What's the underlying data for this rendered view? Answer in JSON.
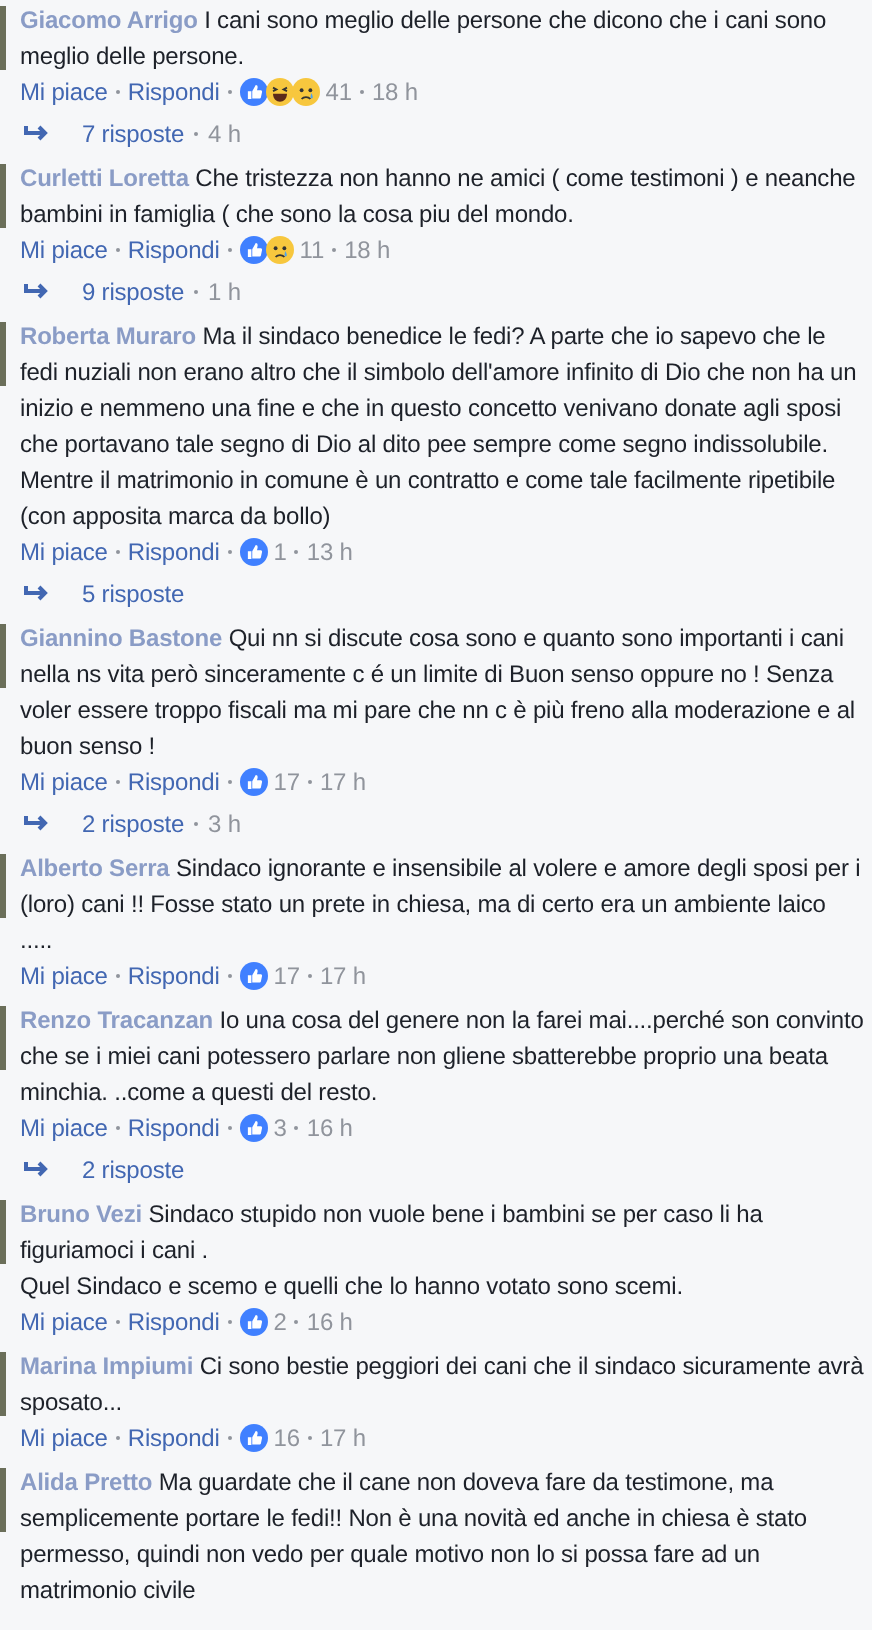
{
  "comments": [
    {
      "author": "Giacomo Arrigo",
      "text": "I cani sono meglio delle persone che dicono che i cani sono meglio delle persone.",
      "like_label": "Mi piace",
      "reply_label": "Rispondi",
      "reactions": [
        {
          "kind": "like"
        },
        {
          "kind": "haha"
        },
        {
          "kind": "sad"
        }
      ],
      "reaction_count": "41",
      "time": "18 h",
      "replies": {
        "count": "7 risposte",
        "time": "4 h"
      }
    },
    {
      "author": "Curletti Loretta",
      "text": "Che tristezza non hanno ne amici ( come testimoni ) e neanche bambini in famiglia ( che sono la cosa piu del mondo.",
      "like_label": "Mi piace",
      "reply_label": "Rispondi",
      "reactions": [
        {
          "kind": "like"
        },
        {
          "kind": "sad"
        }
      ],
      "reaction_count": "11",
      "time": "18 h",
      "replies": {
        "count": "9 risposte",
        "time": "1 h"
      }
    },
    {
      "author": "Roberta Muraro",
      "text": "Ma il sindaco benedice le fedi? A parte che io sapevo che le fedi nuziali non erano altro che il simbolo dell'amore infinito di Dio che non ha un inizio e nemmeno una fine e che in questo concetto venivano donate agli sposi che portavano tale segno di Dio al dito pee sempre come segno indissolubile. Mentre il matrimonio in comune è un contratto e come tale facilmente ripetibile (con apposita marca da bollo)",
      "like_label": "Mi piace",
      "reply_label": "Rispondi",
      "reactions": [
        {
          "kind": "like"
        }
      ],
      "reaction_count": "1",
      "time": "13 h",
      "replies": {
        "count": "5 risposte"
      }
    },
    {
      "author": "Giannino Bastone",
      "text": "Qui nn si discute cosa sono e quanto sono importanti i cani nella ns vita però sinceramente c é un limite di Buon senso oppure no ! Senza voler essere troppo fiscali ma mi pare che nn c è più freno alla moderazione e al buon senso !",
      "like_label": "Mi piace",
      "reply_label": "Rispondi",
      "reactions": [
        {
          "kind": "like"
        }
      ],
      "reaction_count": "17",
      "time": "17 h",
      "replies": {
        "count": "2 risposte",
        "time": "3 h"
      }
    },
    {
      "author": "Alberto Serra",
      "text": "Sindaco ignorante e insensibile al volere e amore degli sposi per i (loro) cani !! Fosse stato un prete in chiesa, ma di certo era un ambiente laico .....",
      "like_label": "Mi piace",
      "reply_label": "Rispondi",
      "reactions": [
        {
          "kind": "like"
        }
      ],
      "reaction_count": "17",
      "time": "17 h"
    },
    {
      "author": "Renzo Tracanzan",
      "text": "Io una cosa del genere non la farei mai....perché son convinto che se i miei cani potessero parlare non gliene sbatterebbe proprio una beata minchia. ..come a questi del resto.",
      "like_label": "Mi piace",
      "reply_label": "Rispondi",
      "reactions": [
        {
          "kind": "like"
        }
      ],
      "reaction_count": "3",
      "time": "16 h",
      "replies": {
        "count": "2 risposte"
      }
    },
    {
      "author": "Bruno Vezi",
      "text": "Sindaco stupido non vuole bene i bambini se per caso li ha figuriamoci i cani .\nQuel Sindaco e scemo e quelli che lo hanno votato sono scemi.",
      "like_label": "Mi piace",
      "reply_label": "Rispondi",
      "reactions": [
        {
          "kind": "like"
        }
      ],
      "reaction_count": "2",
      "time": "16 h"
    },
    {
      "author": "Marina Impiumi",
      "text": "Ci sono bestie peggiori dei cani che il sindaco sicuramente avrà sposato...",
      "like_label": "Mi piace",
      "reply_label": "Rispondi",
      "reactions": [
        {
          "kind": "like"
        }
      ],
      "reaction_count": "16",
      "time": "17 h"
    },
    {
      "author": "Alida Pretto",
      "text": "Ma guardate che il cane non doveva fare da testimone, ma semplicemente portare le fedi!! Non è una novità ed anche in chiesa è stato permesso, quindi non vedo per quale motivo non lo si possa fare ad un matrimonio civile"
    }
  ]
}
